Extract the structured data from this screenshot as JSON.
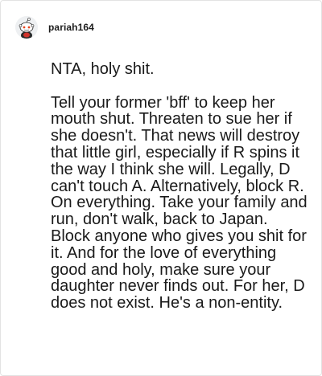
{
  "comment": {
    "username": "pariah164",
    "avatar_icon": "reddit-snoo-avatar-icon",
    "paragraphs": [
      "NTA, holy shit.",
      "Tell your former 'bff' to keep her mouth shut. Threaten to sue her if she doesn't. That news will destroy that little girl, especially if R spins it the way I think she will. Legally, D can't touch A. Alternatively, block R. On everything. Take your family and run, don't walk, back to Japan. Block anyone who gives you shit for it. And for the love of everything good and holy, make sure your daughter never finds out. For her, D does not exist. He's a non-entity."
    ]
  },
  "colors": {
    "text": "#1a1a1a",
    "username": "#1c1c1c",
    "border": "#e3e3e3",
    "background": "#ffffff"
  }
}
